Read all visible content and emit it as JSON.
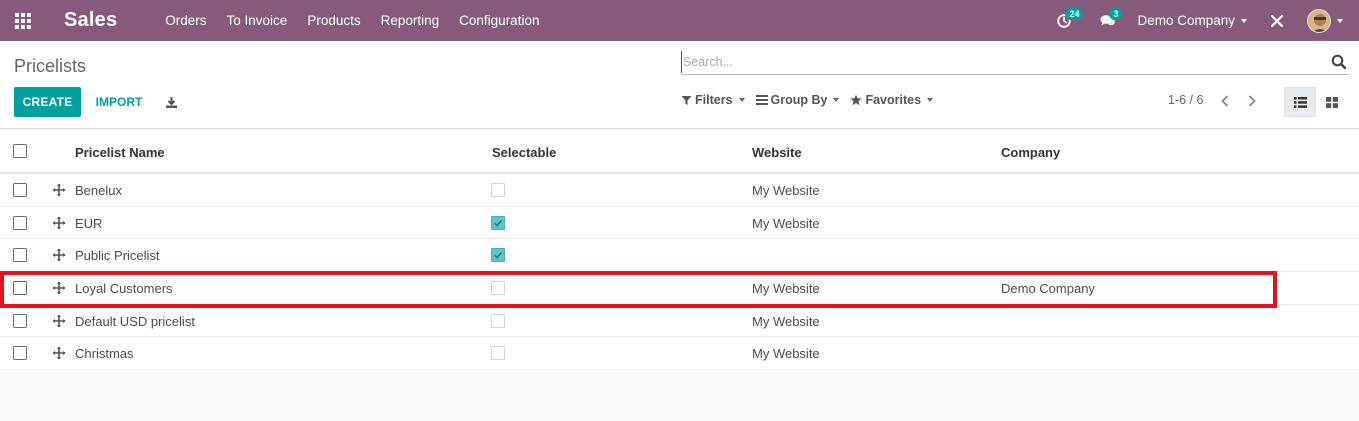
{
  "nav": {
    "brand": "Sales",
    "menu": [
      "Orders",
      "To Invoice",
      "Products",
      "Reporting",
      "Configuration"
    ],
    "activity_count": "24",
    "messages_count": "3",
    "company": "Demo Company"
  },
  "control": {
    "breadcrumb": "Pricelists",
    "create_label": "CREATE",
    "import_label": "IMPORT",
    "search_placeholder": "Search...",
    "filters_label": "Filters",
    "groupby_label": "Group By",
    "favorites_label": "Favorites",
    "pager": "1-6 / 6"
  },
  "table": {
    "columns": [
      "Pricelist Name",
      "Selectable",
      "Website",
      "Company"
    ],
    "rows": [
      {
        "name": "Benelux",
        "selectable": false,
        "website": "My Website",
        "company": ""
      },
      {
        "name": "EUR",
        "selectable": true,
        "website": "My Website",
        "company": ""
      },
      {
        "name": "Public Pricelist",
        "selectable": true,
        "website": "",
        "company": ""
      },
      {
        "name": "Loyal Customers",
        "selectable": false,
        "website": "My Website",
        "company": "Demo Company"
      },
      {
        "name": "Default USD pricelist",
        "selectable": false,
        "website": "My Website",
        "company": ""
      },
      {
        "name": "Christmas",
        "selectable": false,
        "website": "My Website",
        "company": ""
      }
    ]
  },
  "colors": {
    "brand": "#875a7b",
    "accent": "#00a09d",
    "highlight": "#e2151f"
  }
}
